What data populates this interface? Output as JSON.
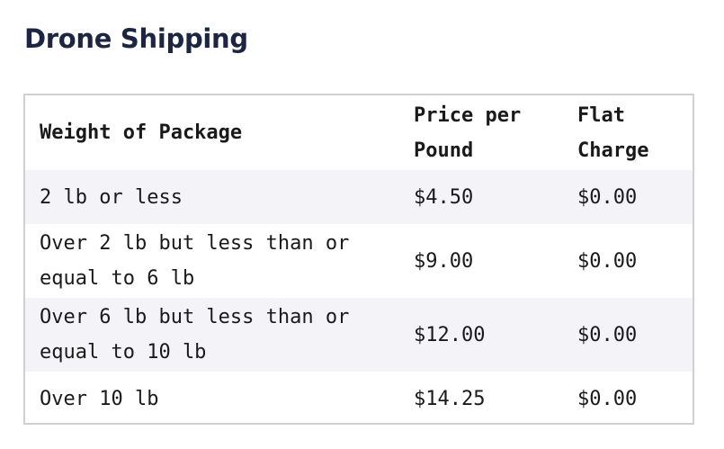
{
  "page": {
    "title": "Drone Shipping"
  },
  "table": {
    "headers": [
      "Weight of Package",
      "Price per Pound",
      "Flat Charge"
    ],
    "rows": [
      [
        "2 lb or less",
        "$4.50",
        "$0.00"
      ],
      [
        "Over 2 lb but less than or equal to 6 lb",
        "$9.00",
        "$0.00"
      ],
      [
        "Over 6 lb but less than or equal to 10 lb",
        "$12.00",
        "$0.00"
      ],
      [
        "Over 10 lb",
        "$14.25",
        "$0.00"
      ]
    ]
  },
  "colors": {
    "title": "#1c2541",
    "border": "#cfd0d4",
    "row_shade": "#f4f4f8"
  }
}
